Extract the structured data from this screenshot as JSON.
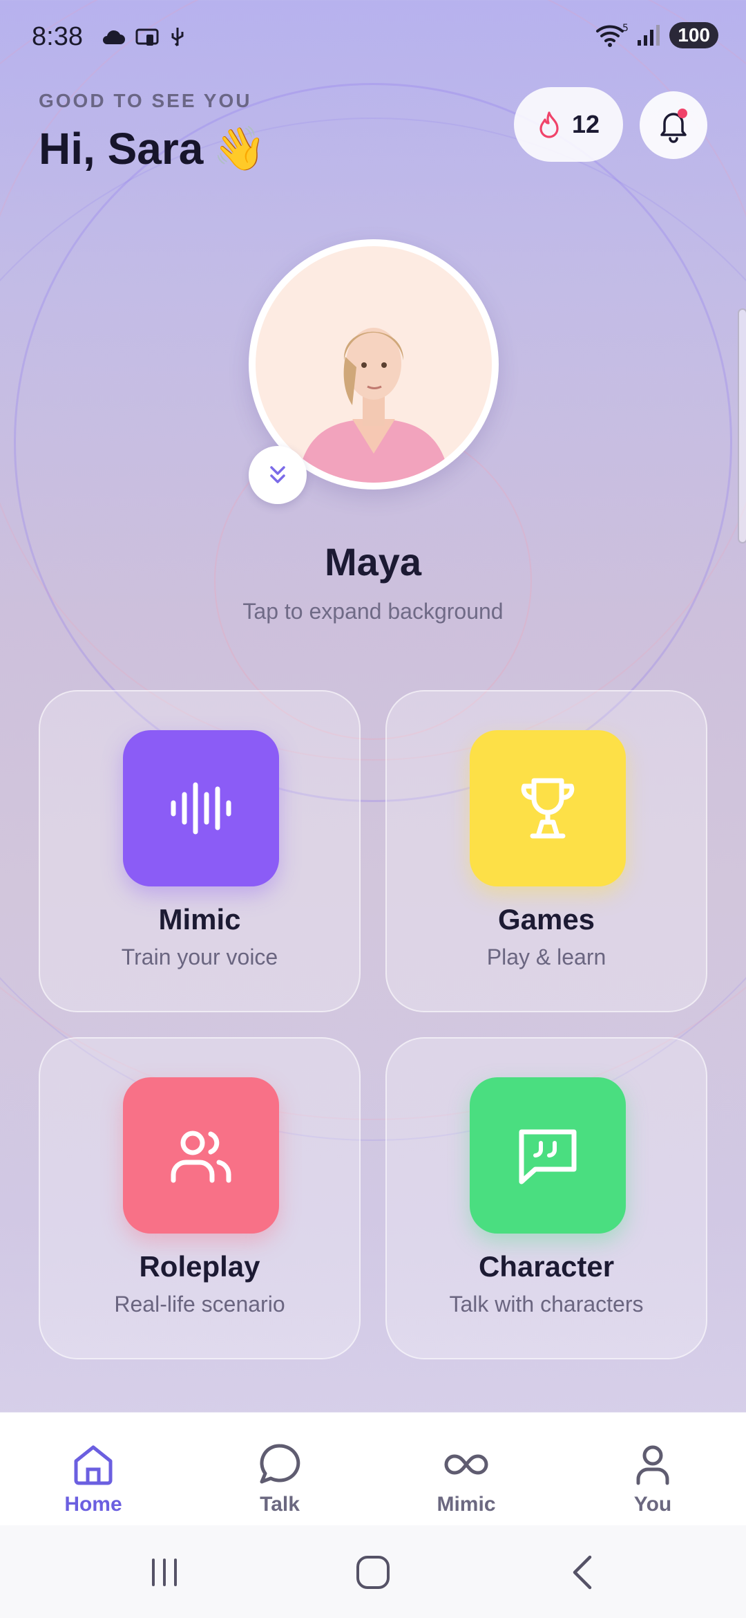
{
  "status_bar": {
    "time": "8:38",
    "battery": "100",
    "signal_badge": "5"
  },
  "header": {
    "greeting_small": "GOOD TO SEE YOU",
    "greeting_big": "Hi, Sara",
    "wave_emoji": "👋",
    "streak_count": "12",
    "streak_icon": "flame-icon",
    "bell_icon": "bell-icon"
  },
  "character": {
    "name": "Maya",
    "hint": "Tap to expand background"
  },
  "cards": [
    {
      "title": "Mimic",
      "subtitle": "Train your voice",
      "icon": "waveform-icon",
      "color": "#8b5cf6"
    },
    {
      "title": "Games",
      "subtitle": "Play & learn",
      "icon": "trophy-icon",
      "color": "#fde047"
    },
    {
      "title": "Roleplay",
      "subtitle": "Real-life scenario",
      "icon": "users-icon",
      "color": "#f87187"
    },
    {
      "title": "Character",
      "subtitle": "Talk with characters",
      "icon": "quote-bubble-icon",
      "color": "#4ade80"
    }
  ],
  "bottom_nav": [
    {
      "label": "Home",
      "icon": "home-icon",
      "active": true
    },
    {
      "label": "Talk",
      "icon": "chat-bubble-icon",
      "active": false
    },
    {
      "label": "Mimic",
      "icon": "infinity-icon",
      "active": false
    },
    {
      "label": "You",
      "icon": "person-icon",
      "active": false
    }
  ],
  "colors": {
    "accent": "#6b5fe0",
    "text_dark": "#1c1a33",
    "notification_dot": "#f0436a"
  }
}
